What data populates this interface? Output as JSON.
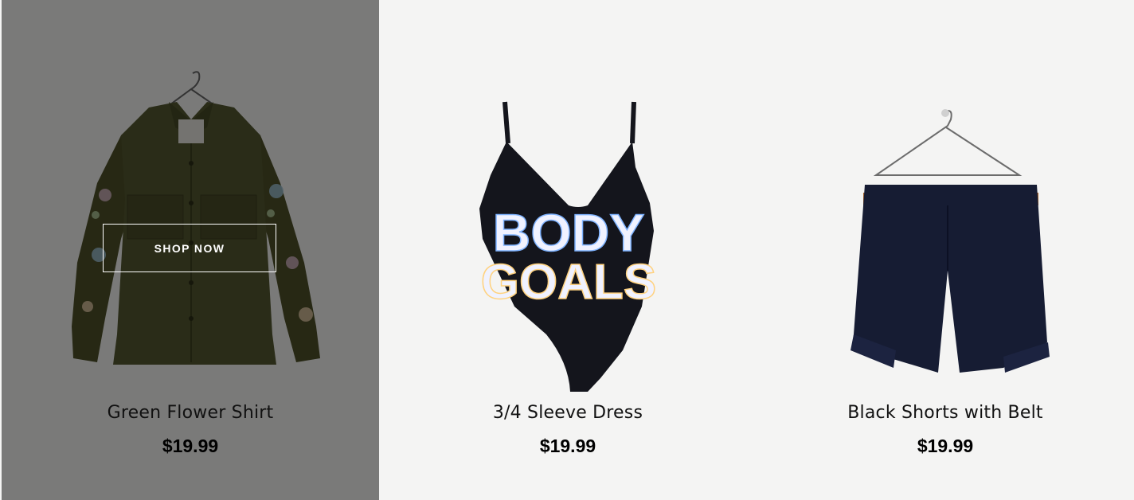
{
  "colors": {
    "background": "#f4f4f3",
    "overlay": "rgba(0,0,0,0.5)",
    "shirt": "#4e5129",
    "dress": "#14151c",
    "shorts": "#161c33",
    "belt": "#a0622e"
  },
  "products": [
    {
      "name": "Green Flower Shirt",
      "price": "$19.99",
      "image": "green-flower-shirt-image",
      "cta": "SHOP NOW",
      "hovered": true
    },
    {
      "name": "3/4 Sleeve Dress",
      "price": "$19.99",
      "image": "black-bodysuit-image",
      "print_line1": "BODY",
      "print_line2": "GOALS"
    },
    {
      "name": "Black Shorts with Belt",
      "price": "$19.99",
      "image": "navy-shorts-image"
    }
  ]
}
